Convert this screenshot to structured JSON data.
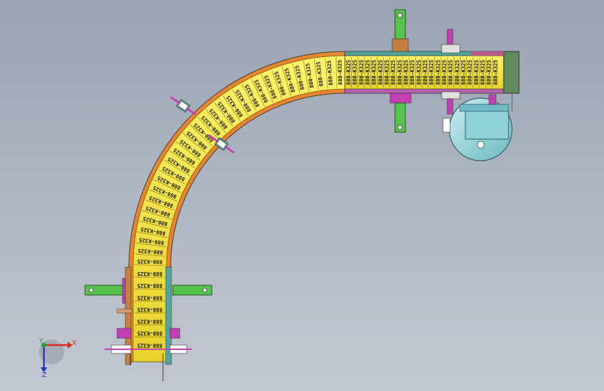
{
  "view": {
    "name": "CAD assembly viewport",
    "chain_link_label": "880-K325",
    "chain_link_count_straight": 24,
    "chain_link_count_curve": 30,
    "chain_link_count_vertical": 7
  },
  "triad": {
    "x_label": "X",
    "y_label": "Y",
    "z_label": "Z"
  },
  "colors": {
    "background_top": "#9aa3b4",
    "chain_yellow": "#f2e23a",
    "frame_orange": "#e8852c",
    "bracket_green": "#55c24a",
    "bolt_magenta": "#c43fb6",
    "motor_cyan": "#8fd0d8",
    "frame_edge_dark": "#3a3a3a"
  },
  "icons": {
    "triad": "xyz-axis-triad-icon"
  }
}
